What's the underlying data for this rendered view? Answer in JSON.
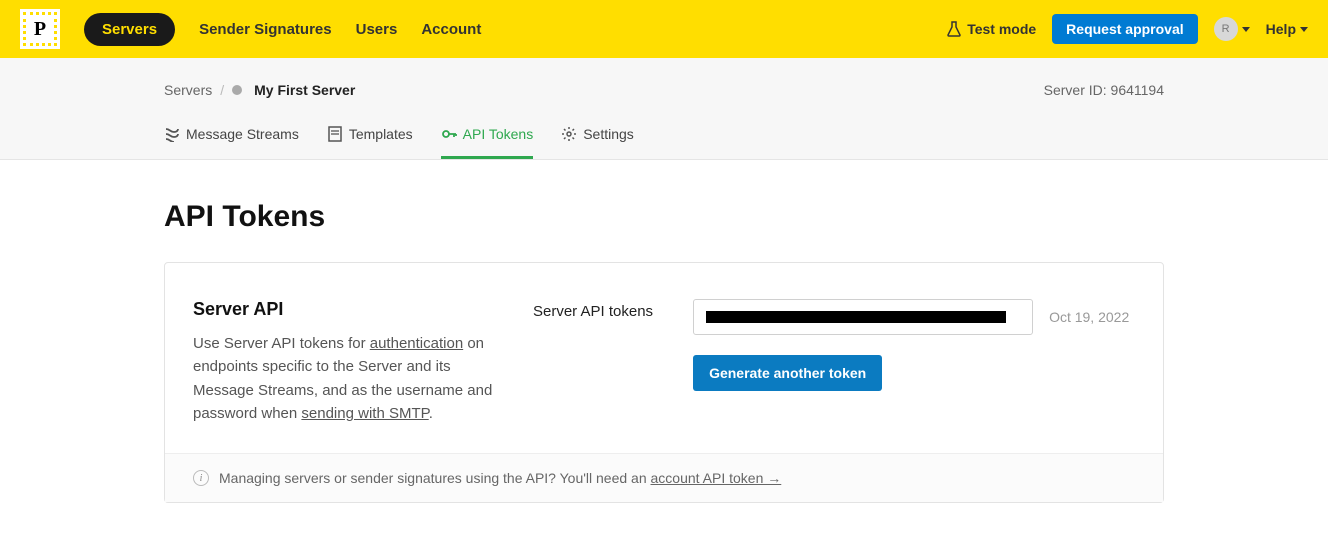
{
  "brand": {
    "logo_letter": "P"
  },
  "nav": {
    "items": [
      {
        "label": "Servers",
        "active": true
      },
      {
        "label": "Sender Signatures",
        "active": false
      },
      {
        "label": "Users",
        "active": false
      },
      {
        "label": "Account",
        "active": false
      }
    ],
    "test_mode_label": "Test mode",
    "request_approval_label": "Request approval",
    "avatar_letter": "R",
    "help_label": "Help"
  },
  "breadcrumb": {
    "root": "Servers",
    "sep": "/",
    "current": "My First Server"
  },
  "server_id": {
    "label": "Server ID:",
    "value": "9641194"
  },
  "tabs": [
    {
      "label": "Message Streams",
      "icon": "streams-icon"
    },
    {
      "label": "Templates",
      "icon": "templates-icon"
    },
    {
      "label": "API Tokens",
      "icon": "key-icon",
      "active": true
    },
    {
      "label": "Settings",
      "icon": "gear-icon"
    }
  ],
  "page": {
    "title": "API Tokens"
  },
  "server_api": {
    "heading": "Server API",
    "desc_prefix": "Use Server API tokens for ",
    "auth_link": "authentication",
    "desc_mid": " on endpoints specific to the Server and its Message Streams, and as the username and password when ",
    "smtp_link": "sending with SMTP",
    "desc_suffix": ".",
    "label": "Server API tokens",
    "token_value": "████████████████████████████████████",
    "token_date": "Oct 19, 2022",
    "generate_label": "Generate another token"
  },
  "footer_note": {
    "text": "Managing servers or sender signatures using the API? You'll need an ",
    "link": "account API token →"
  }
}
